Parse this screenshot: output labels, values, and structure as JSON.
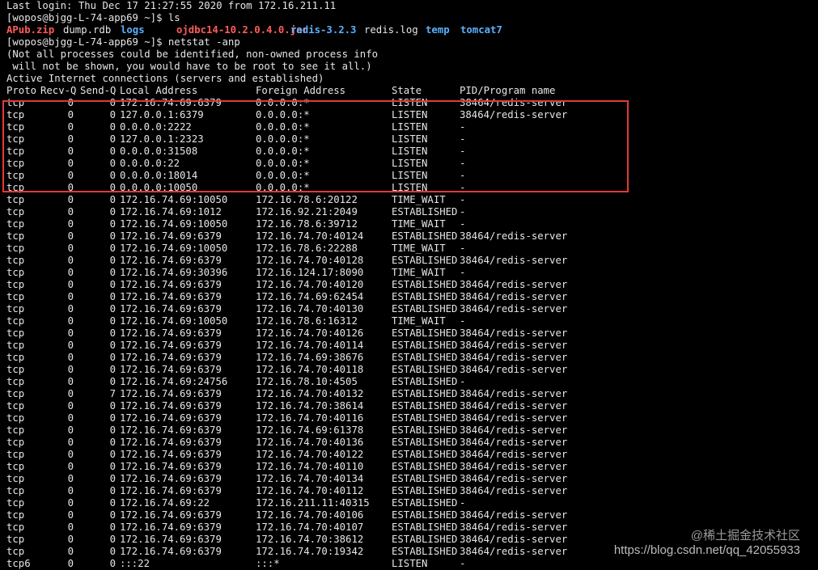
{
  "terminal": {
    "last_login": "Last login: Thu Dec 17 21:27:55 2020 from 172.16.211.11",
    "prompt_ls": "[wopos@bjgg-L-74-app69 ~]$ ls",
    "ls_items": [
      {
        "text": "APub.zip",
        "type": "zip"
      },
      {
        "text": "dump.rdb",
        "type": "plain"
      },
      {
        "text": "logs",
        "type": "dir"
      },
      {
        "text": "ojdbc14-10.2.0.4.0.jar",
        "type": "zip"
      },
      {
        "text": "redis-3.2.3",
        "type": "dir"
      },
      {
        "text": "redis.log",
        "type": "plain"
      },
      {
        "text": "temp",
        "type": "dir"
      },
      {
        "text": "tomcat7",
        "type": "dir"
      }
    ],
    "prompt_netstat": "[wopos@bjgg-L-74-app69 ~]$ netstat -anp",
    "notice_1": "(Not all processes could be identified, non-owned process info",
    "notice_2": " will not be shown, you would have to be root to see it all.)",
    "active_header": "Active Internet connections (servers and established)",
    "columns": [
      "Proto",
      "Recv-Q",
      "Send-Q",
      "Local Address",
      "Foreign Address",
      "State",
      "PID/Program name"
    ],
    "rows": [
      [
        "tcp",
        "0",
        "0",
        "172.16.74.69:6379",
        "0.0.0.0:*",
        "LISTEN",
        "38464/redis-server"
      ],
      [
        "tcp",
        "0",
        "0",
        "127.0.0.1:6379",
        "0.0.0.0:*",
        "LISTEN",
        "38464/redis-server"
      ],
      [
        "tcp",
        "0",
        "0",
        "0.0.0.0:2222",
        "0.0.0.0:*",
        "LISTEN",
        "-"
      ],
      [
        "tcp",
        "0",
        "0",
        "127.0.0.1:2323",
        "0.0.0.0:*",
        "LISTEN",
        "-"
      ],
      [
        "tcp",
        "0",
        "0",
        "0.0.0.0:31508",
        "0.0.0.0:*",
        "LISTEN",
        "-"
      ],
      [
        "tcp",
        "0",
        "0",
        "0.0.0.0:22",
        "0.0.0.0:*",
        "LISTEN",
        "-"
      ],
      [
        "tcp",
        "0",
        "0",
        "0.0.0.0:18014",
        "0.0.0.0:*",
        "LISTEN",
        "-"
      ],
      [
        "tcp",
        "0",
        "0",
        "0.0.0.0:10050",
        "0.0.0.0:*",
        "LISTEN",
        "-"
      ],
      [
        "tcp",
        "0",
        "0",
        "172.16.74.69:10050",
        "172.16.78.6:20122",
        "TIME_WAIT",
        "-"
      ],
      [
        "tcp",
        "0",
        "0",
        "172.16.74.69:1012",
        "172.16.92.21:2049",
        "ESTABLISHED",
        "-"
      ],
      [
        "tcp",
        "0",
        "0",
        "172.16.74.69:10050",
        "172.16.78.6:39712",
        "TIME_WAIT",
        "-"
      ],
      [
        "tcp",
        "0",
        "0",
        "172.16.74.69:6379",
        "172.16.74.70:40124",
        "ESTABLISHED",
        "38464/redis-server"
      ],
      [
        "tcp",
        "0",
        "0",
        "172.16.74.69:10050",
        "172.16.78.6:22288",
        "TIME_WAIT",
        "-"
      ],
      [
        "tcp",
        "0",
        "0",
        "172.16.74.69:6379",
        "172.16.74.70:40128",
        "ESTABLISHED",
        "38464/redis-server"
      ],
      [
        "tcp",
        "0",
        "0",
        "172.16.74.69:30396",
        "172.16.124.17:8090",
        "TIME_WAIT",
        "-"
      ],
      [
        "tcp",
        "0",
        "0",
        "172.16.74.69:6379",
        "172.16.74.70:40120",
        "ESTABLISHED",
        "38464/redis-server"
      ],
      [
        "tcp",
        "0",
        "0",
        "172.16.74.69:6379",
        "172.16.74.69:62454",
        "ESTABLISHED",
        "38464/redis-server"
      ],
      [
        "tcp",
        "0",
        "0",
        "172.16.74.69:6379",
        "172.16.74.70:40130",
        "ESTABLISHED",
        "38464/redis-server"
      ],
      [
        "tcp",
        "0",
        "0",
        "172.16.74.69:10050",
        "172.16.78.6:16312",
        "TIME_WAIT",
        "-"
      ],
      [
        "tcp",
        "0",
        "0",
        "172.16.74.69:6379",
        "172.16.74.70:40126",
        "ESTABLISHED",
        "38464/redis-server"
      ],
      [
        "tcp",
        "0",
        "0",
        "172.16.74.69:6379",
        "172.16.74.70:40114",
        "ESTABLISHED",
        "38464/redis-server"
      ],
      [
        "tcp",
        "0",
        "0",
        "172.16.74.69:6379",
        "172.16.74.69:38676",
        "ESTABLISHED",
        "38464/redis-server"
      ],
      [
        "tcp",
        "0",
        "0",
        "172.16.74.69:6379",
        "172.16.74.70:40118",
        "ESTABLISHED",
        "38464/redis-server"
      ],
      [
        "tcp",
        "0",
        "0",
        "172.16.74.69:24756",
        "172.16.78.10:4505",
        "ESTABLISHED",
        "-"
      ],
      [
        "tcp",
        "0",
        "7",
        "172.16.74.69:6379",
        "172.16.74.70:40132",
        "ESTABLISHED",
        "38464/redis-server"
      ],
      [
        "tcp",
        "0",
        "0",
        "172.16.74.69:6379",
        "172.16.74.70:38614",
        "ESTABLISHED",
        "38464/redis-server"
      ],
      [
        "tcp",
        "0",
        "0",
        "172.16.74.69:6379",
        "172.16.74.70:40116",
        "ESTABLISHED",
        "38464/redis-server"
      ],
      [
        "tcp",
        "0",
        "0",
        "172.16.74.69:6379",
        "172.16.74.69:61378",
        "ESTABLISHED",
        "38464/redis-server"
      ],
      [
        "tcp",
        "0",
        "0",
        "172.16.74.69:6379",
        "172.16.74.70:40136",
        "ESTABLISHED",
        "38464/redis-server"
      ],
      [
        "tcp",
        "0",
        "0",
        "172.16.74.69:6379",
        "172.16.74.70:40122",
        "ESTABLISHED",
        "38464/redis-server"
      ],
      [
        "tcp",
        "0",
        "0",
        "172.16.74.69:6379",
        "172.16.74.70:40110",
        "ESTABLISHED",
        "38464/redis-server"
      ],
      [
        "tcp",
        "0",
        "0",
        "172.16.74.69:6379",
        "172.16.74.70:40134",
        "ESTABLISHED",
        "38464/redis-server"
      ],
      [
        "tcp",
        "0",
        "0",
        "172.16.74.69:6379",
        "172.16.74.70:40112",
        "ESTABLISHED",
        "38464/redis-server"
      ],
      [
        "tcp",
        "0",
        "0",
        "172.16.74.69:22",
        "172.16.211.11:40315",
        "ESTABLISHED",
        "-"
      ],
      [
        "tcp",
        "0",
        "0",
        "172.16.74.69:6379",
        "172.16.74.70:40106",
        "ESTABLISHED",
        "38464/redis-server"
      ],
      [
        "tcp",
        "0",
        "0",
        "172.16.74.69:6379",
        "172.16.74.70:40107",
        "ESTABLISHED",
        "38464/redis-server"
      ],
      [
        "tcp",
        "0",
        "0",
        "172.16.74.69:6379",
        "172.16.74.70:38612",
        "ESTABLISHED",
        "38464/redis-server"
      ],
      [
        "tcp",
        "0",
        "0",
        "172.16.74.69:6379",
        "172.16.74.70:19342",
        "ESTABLISHED",
        "38464/redis-server"
      ],
      [
        "tcp6",
        "0",
        "0",
        ":::22",
        ":::*",
        "LISTEN",
        "-"
      ]
    ]
  },
  "watermark": {
    "line1": "@稀土掘金技术社区",
    "line2": "https://blog.csdn.net/qq_42055933"
  },
  "colors": {
    "background": "#000000",
    "text": "#e6e6e6",
    "zip_file": "#ff5c5c",
    "directory": "#5ab0ff",
    "highlight_border": "#e03a3a"
  }
}
